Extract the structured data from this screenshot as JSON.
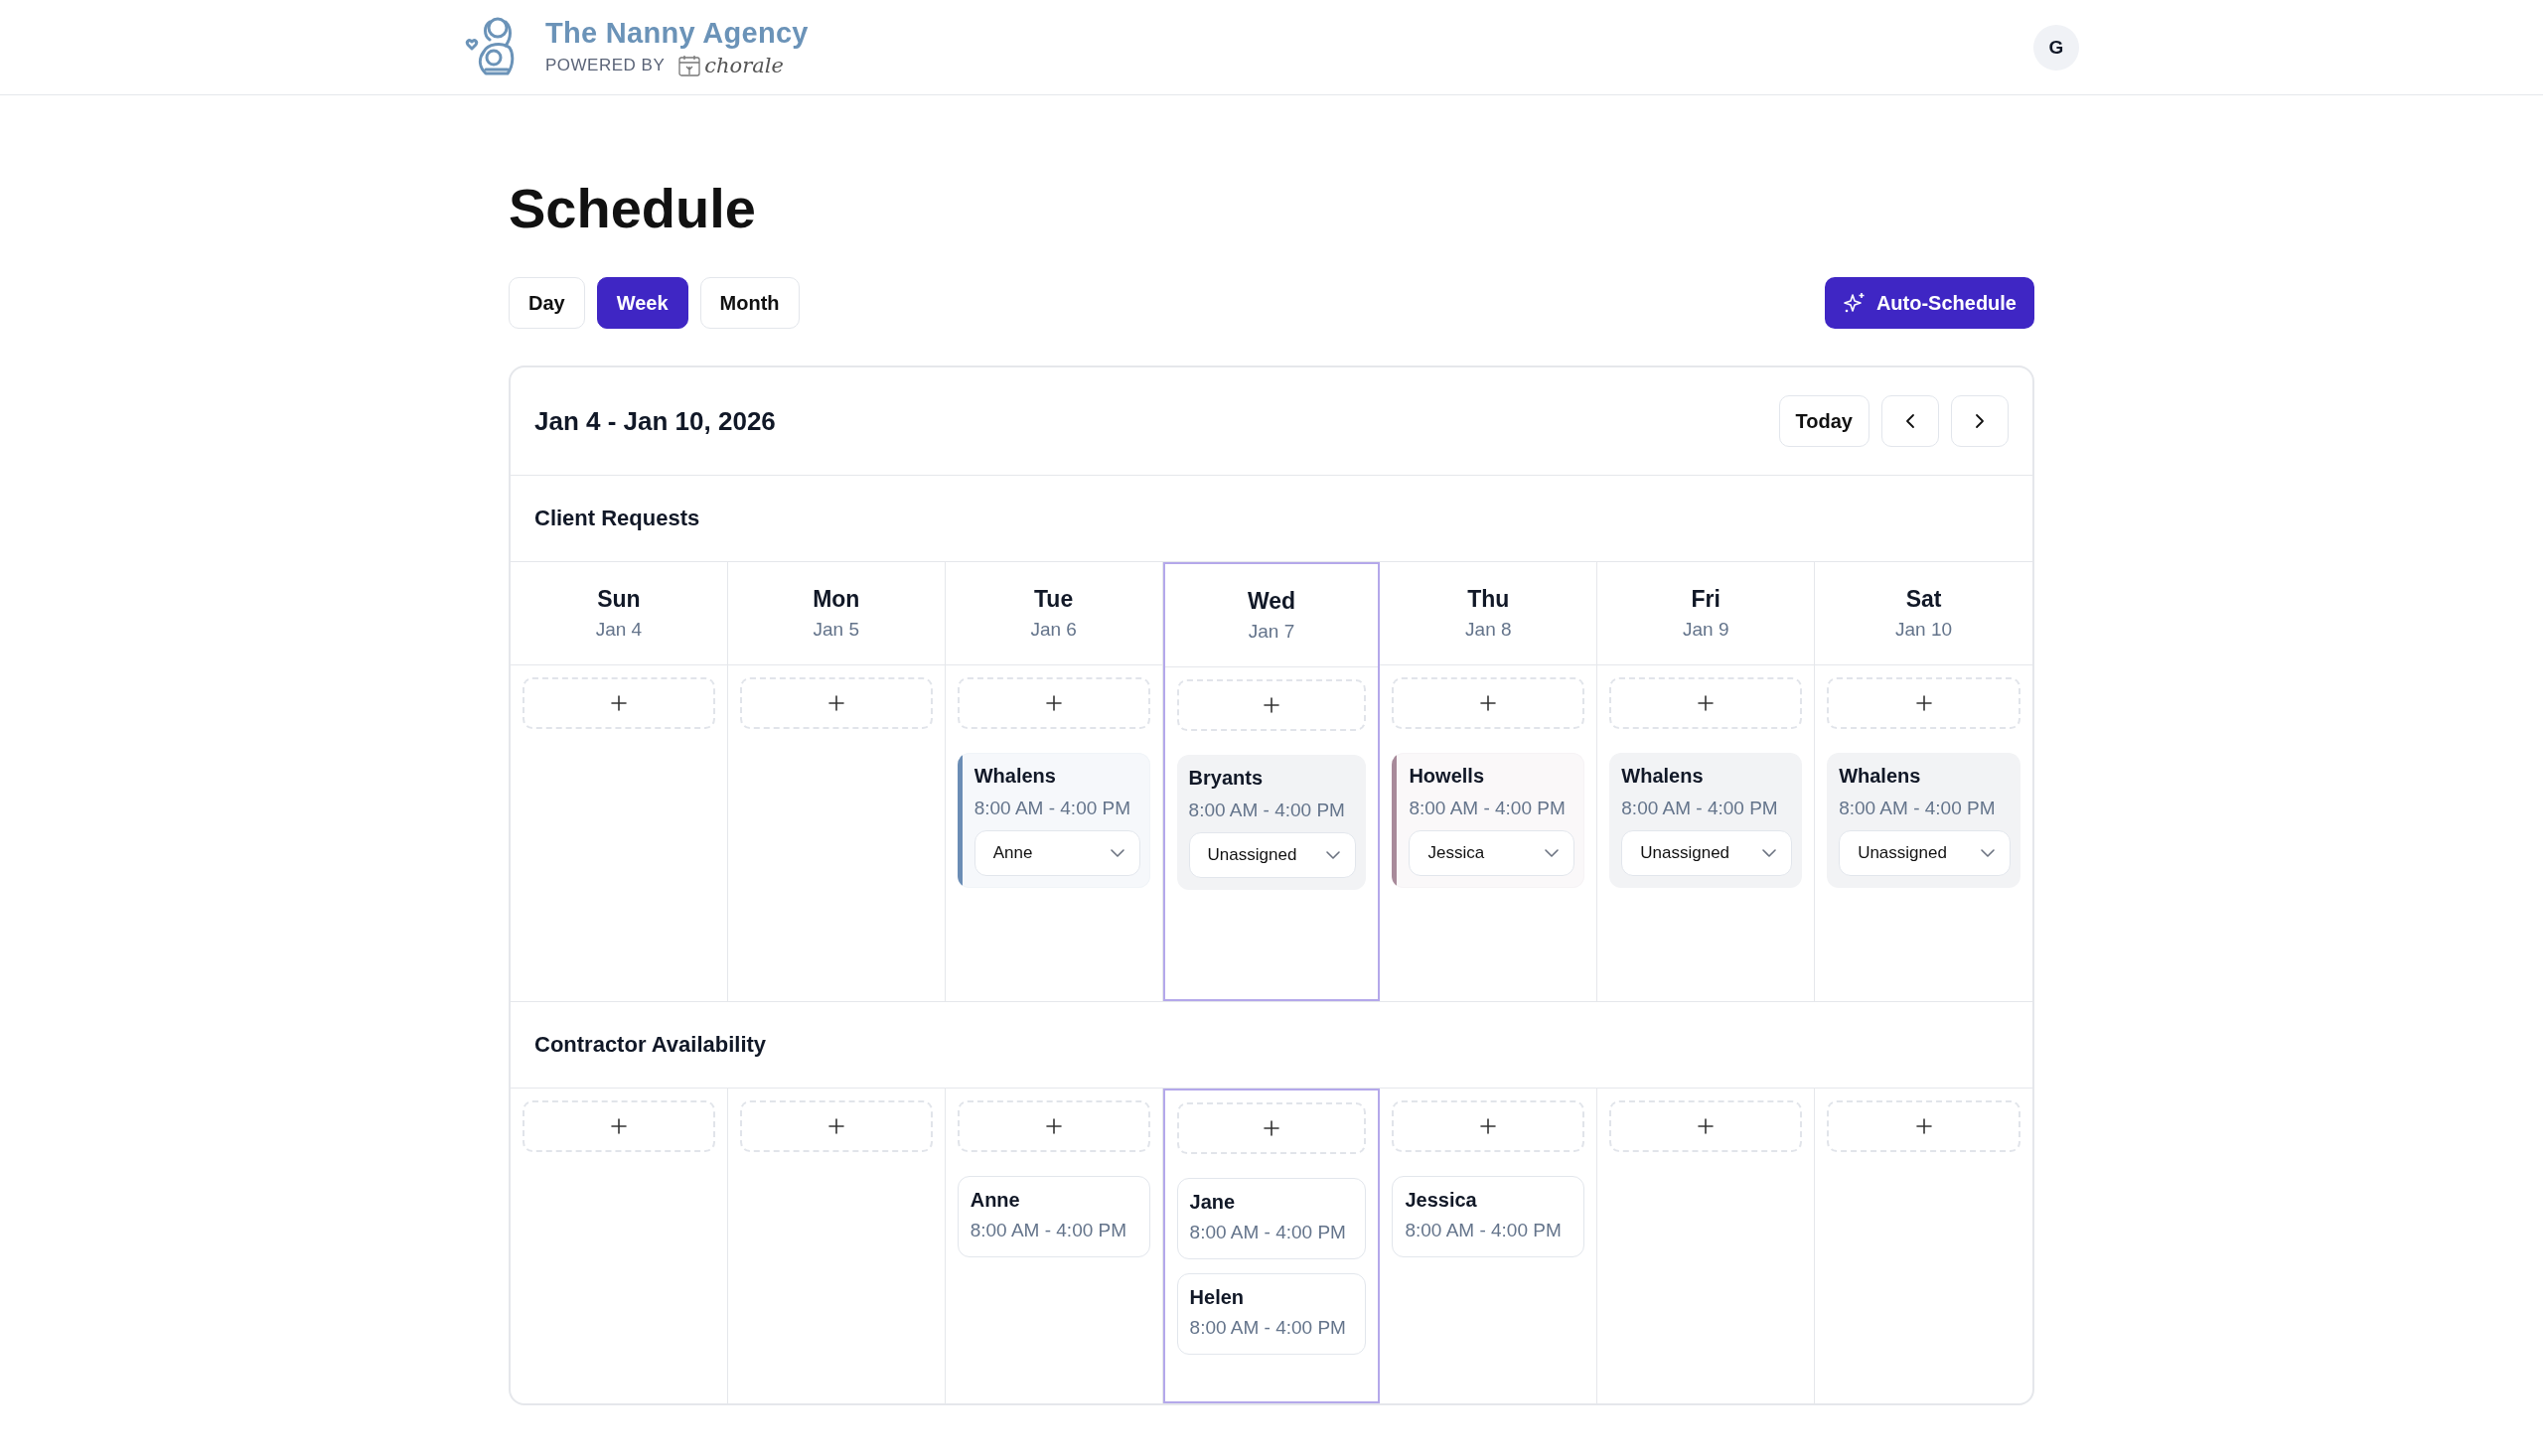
{
  "header": {
    "brand": "The Nanny Agency",
    "powered_by": "POWERED BY",
    "partner": "chorale",
    "avatar": "G"
  },
  "page_title": "Schedule",
  "view_tabs": [
    {
      "label": "Day",
      "selected": false
    },
    {
      "label": "Week",
      "selected": true
    },
    {
      "label": "Month",
      "selected": false
    }
  ],
  "auto_schedule_button": "Auto-Schedule",
  "calendar": {
    "range": "Jan 4 - Jan 10, 2026",
    "today_button": "Today",
    "requests_title": "Client Requests",
    "availability_title": "Contractor Availability",
    "days": [
      {
        "name": "Sun",
        "date": "Jan 4",
        "selected": false
      },
      {
        "name": "Mon",
        "date": "Jan 5",
        "selected": false
      },
      {
        "name": "Tue",
        "date": "Jan 6",
        "selected": false,
        "requests": [
          {
            "client": "Whalens",
            "time": "8:00 AM - 4:00 PM",
            "assignee": "Anne",
            "kind": "assigned",
            "color": "#6b8db5"
          }
        ],
        "availability": [
          {
            "name": "Anne",
            "time": "8:00 AM - 4:00 PM"
          }
        ]
      },
      {
        "name": "Wed",
        "date": "Jan 7",
        "selected": true,
        "requests": [
          {
            "client": "Bryants",
            "time": "8:00 AM - 4:00 PM",
            "assignee": "Unassigned",
            "kind": "unassigned"
          }
        ],
        "availability": [
          {
            "name": "Jane",
            "time": "8:00 AM - 4:00 PM"
          },
          {
            "name": "Helen",
            "time": "8:00 AM - 4:00 PM"
          }
        ]
      },
      {
        "name": "Thu",
        "date": "Jan 8",
        "selected": false,
        "requests": [
          {
            "client": "Howells",
            "time": "8:00 AM - 4:00 PM",
            "assignee": "Jessica",
            "kind": "assigned",
            "color": "#a88a9a"
          }
        ],
        "availability": [
          {
            "name": "Jessica",
            "time": "8:00 AM - 4:00 PM"
          }
        ]
      },
      {
        "name": "Fri",
        "date": "Jan 9",
        "selected": false,
        "requests": [
          {
            "client": "Whalens",
            "time": "8:00 AM - 4:00 PM",
            "assignee": "Unassigned",
            "kind": "unassigned"
          }
        ]
      },
      {
        "name": "Sat",
        "date": "Jan 10",
        "selected": false,
        "requests": [
          {
            "client": "Whalens",
            "time": "8:00 AM - 4:00 PM",
            "assignee": "Unassigned",
            "kind": "unassigned"
          }
        ]
      }
    ]
  }
}
